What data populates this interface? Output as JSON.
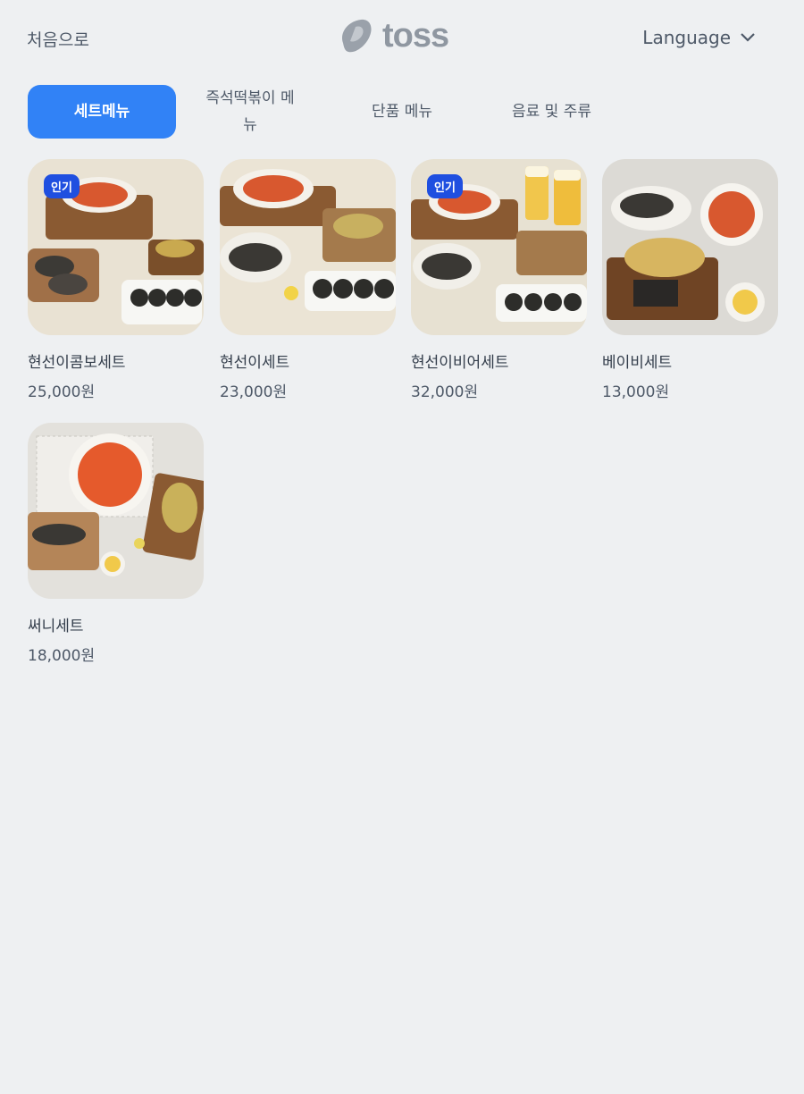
{
  "header": {
    "home_label": "처음으로",
    "logo_text": "toss",
    "language_label": "Language"
  },
  "tabs": [
    {
      "label": "세트메뉴",
      "active": true
    },
    {
      "label": "즉석떡볶이 메뉴",
      "active": false
    },
    {
      "label": "단품 메뉴",
      "active": false
    },
    {
      "label": "음료 및 주류",
      "active": false
    }
  ],
  "products": [
    {
      "name": "현선이콤보세트",
      "price": "25,000원",
      "badge": "인기"
    },
    {
      "name": "현선이세트",
      "price": "23,000원"
    },
    {
      "name": "현선이비어세트",
      "price": "32,000원",
      "badge": "인기"
    },
    {
      "name": "베이비세트",
      "price": "13,000원"
    },
    {
      "name": "써니세트",
      "price": "18,000원"
    }
  ],
  "colors": {
    "accent": "#3182f6",
    "badge": "#1f4fe0",
    "background": "#eef0f2"
  }
}
